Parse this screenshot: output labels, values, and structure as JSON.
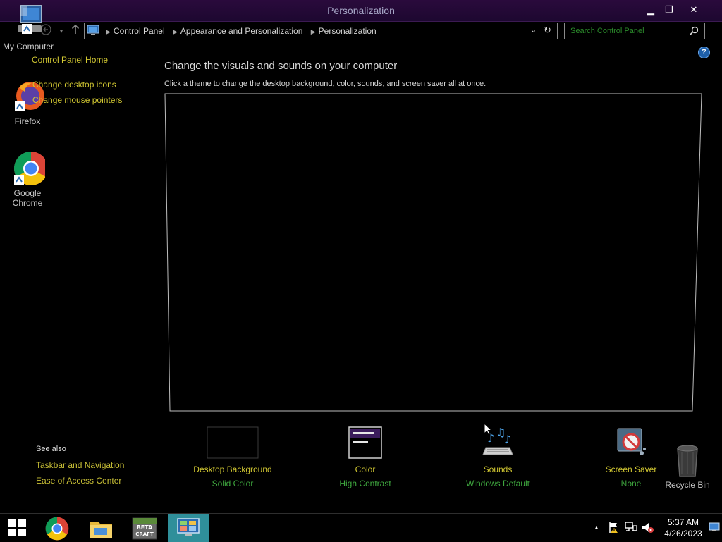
{
  "window": {
    "title": "Personalization",
    "minimize_glyph": "▁",
    "restore_glyph": "❐",
    "close_glyph": "✕"
  },
  "address_bar": {
    "crumbs": [
      "Control Panel",
      "Appearance and Personalization",
      "Personalization"
    ],
    "search_placeholder": "Search Control Panel"
  },
  "left_panel": {
    "home_link": "Control Panel Home",
    "links": [
      "Change desktop icons",
      "Change mouse pointers"
    ],
    "see_also_heading": "See also",
    "see_also_links": [
      "Taskbar and Navigation",
      "Ease of Access Center"
    ]
  },
  "main": {
    "heading": "Change the visuals and sounds on your computer",
    "subtext": "Click a theme to change the desktop background, color, sounds, and screen saver all at once.",
    "help_glyph": "?"
  },
  "tiles": [
    {
      "label": "Desktop Background",
      "value": "Solid Color",
      "icon": "desktop-background-icon"
    },
    {
      "label": "Color",
      "value": "High Contrast",
      "icon": "color-icon"
    },
    {
      "label": "Sounds",
      "value": "Windows Default",
      "icon": "sounds-icon"
    },
    {
      "label": "Screen Saver",
      "value": "None",
      "icon": "screen-saver-icon"
    }
  ],
  "desktop_icons": {
    "my_computer": "My Computer",
    "firefox": "Firefox",
    "chrome_line1": "Google",
    "chrome_line2": "Chrome",
    "recycle_bin": "Recycle Bin"
  },
  "taskbar": {
    "time": "5:37 AM",
    "date": "4/26/2023",
    "minecraft_text_1": "BETA",
    "minecraft_text_2": "CRAFT",
    "tray_up_glyph": "▲"
  },
  "colors": {
    "link_yellow": "#d2c832",
    "value_green": "#3fa83f",
    "title_purple": "#2a0a3c"
  }
}
